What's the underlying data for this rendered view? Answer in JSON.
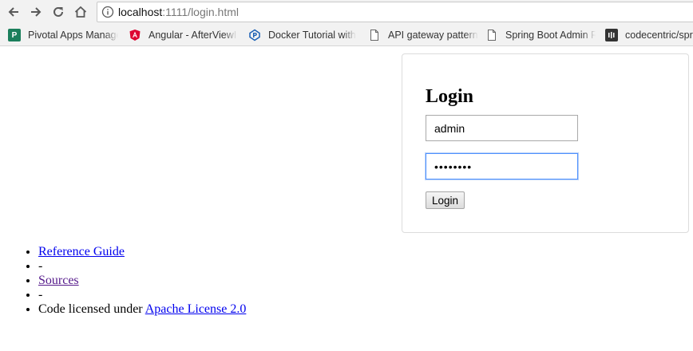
{
  "browser": {
    "url_host": "localhost",
    "url_path": ":1111/login.html",
    "bookmarks": [
      {
        "label": "Pivotal Apps Manager",
        "icon": "pivotal-icon",
        "color": "#1b7f5c",
        "glyph": "P"
      },
      {
        "label": "Angular - AfterViewInit",
        "icon": "angular-icon",
        "color": "#dd0031",
        "glyph": "A"
      },
      {
        "label": "Docker Tutorial with",
        "icon": "docker-icon",
        "color": "#1a5fb4",
        "glyph": "P"
      },
      {
        "label": "API gateway pattern",
        "icon": "page-icon",
        "color": "#888888",
        "glyph": ""
      },
      {
        "label": "Spring Boot Admin R",
        "icon": "page-icon",
        "color": "#888888",
        "glyph": ""
      },
      {
        "label": "codecentric/spr",
        "icon": "github-icon",
        "color": "#333333",
        "glyph": ""
      }
    ]
  },
  "login": {
    "title": "Login",
    "username_value": "admin",
    "password_value": "••••••••",
    "button_label": "Login",
    "focus_color": "#4d90fe"
  },
  "footer": {
    "items": [
      {
        "type": "link",
        "text": "Reference Guide",
        "visited": false
      },
      {
        "type": "text",
        "text": "-"
      },
      {
        "type": "link",
        "text": "Sources",
        "visited": true
      },
      {
        "type": "text",
        "text": "-"
      },
      {
        "type": "mixed",
        "text": "Code licensed under ",
        "link_text": "Apache License 2.0"
      }
    ]
  }
}
